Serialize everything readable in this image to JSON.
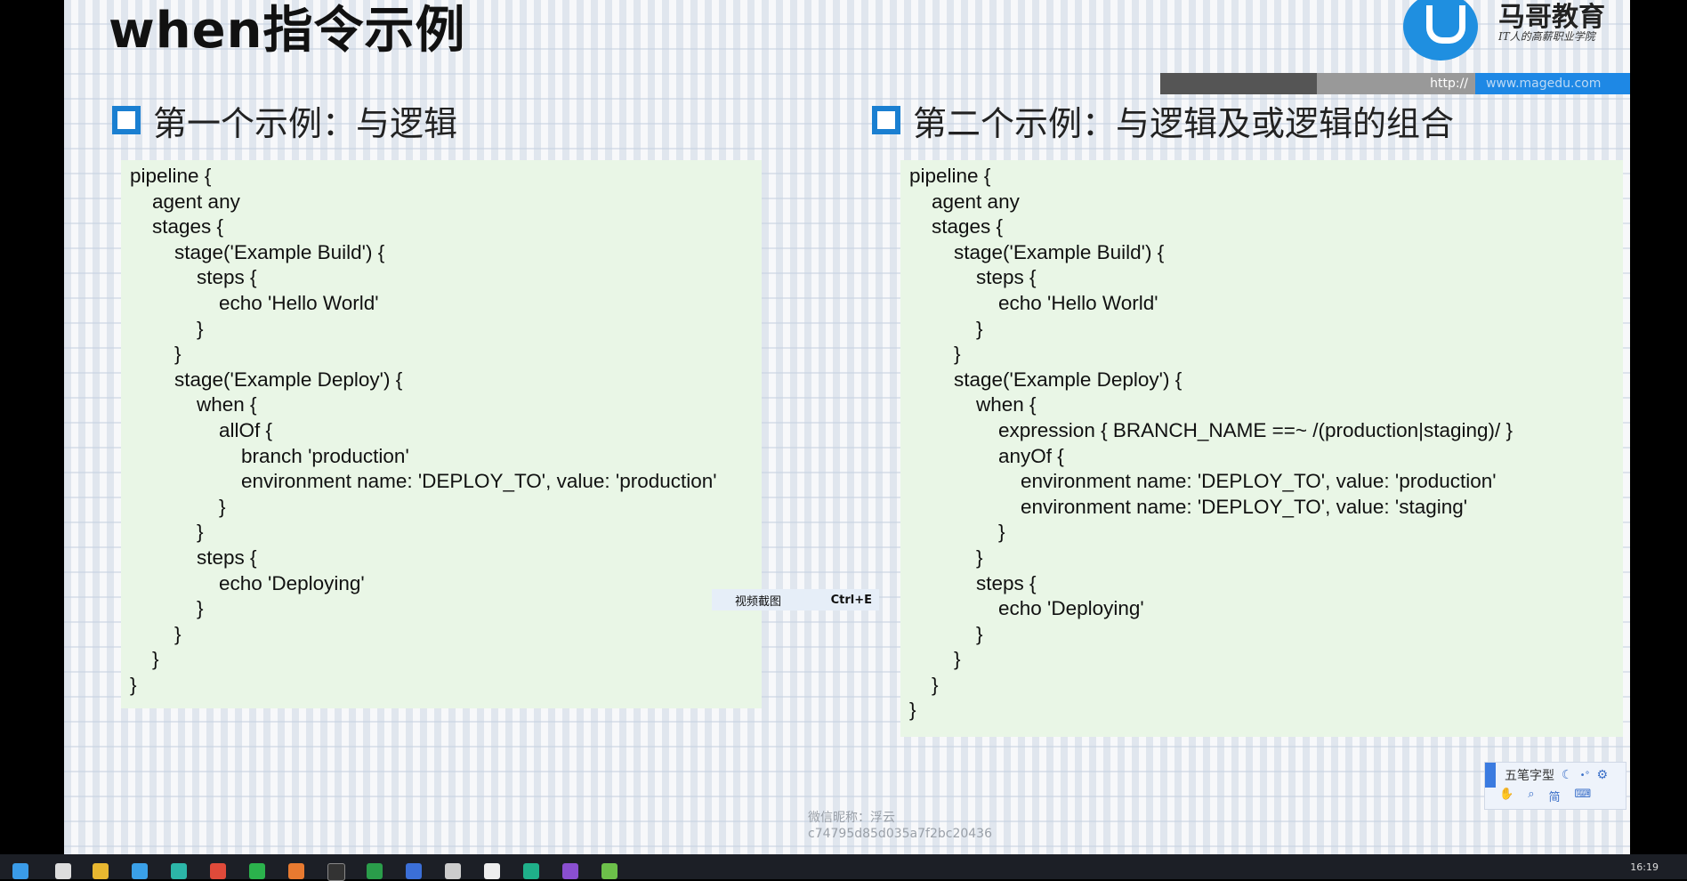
{
  "slide": {
    "title": "when指令示例",
    "logo": {
      "name": "马哥教育",
      "slogan": "IT人的高薪职业学院"
    },
    "urlbar": {
      "prefix": "http://",
      "site": "www.magedu.com"
    },
    "example1": {
      "heading": "第一个示例：与逻辑",
      "code": [
        "pipeline {",
        "    agent any",
        "    stages {",
        "        stage('Example Build') {",
        "            steps {",
        "                echo 'Hello World'",
        "            }",
        "        }",
        "        stage('Example Deploy') {",
        "            when {",
        "                allOf {",
        "                    branch 'production'",
        "                    environment name: 'DEPLOY_TO', value: 'production'",
        "                }",
        "            }",
        "            steps {",
        "                echo 'Deploying'",
        "            }",
        "        }",
        "    }",
        "}"
      ]
    },
    "example2": {
      "heading": "第二个示例：与逻辑及或逻辑的组合",
      "code": [
        "pipeline {",
        "    agent any",
        "    stages {",
        "        stage('Example Build') {",
        "            steps {",
        "                echo 'Hello World'",
        "            }",
        "        }",
        "        stage('Example Deploy') {",
        "            when {",
        "                expression { BRANCH_NAME ==~ /(production|staging)/ }",
        "                anyOf {",
        "                    environment name: 'DEPLOY_TO', value: 'production'",
        "                    environment name: 'DEPLOY_TO', value: 'staging'",
        "                }",
        "            }",
        "            steps {",
        "                echo 'Deploying'",
        "            }",
        "        }",
        "    }",
        "}"
      ]
    }
  },
  "tooltip": {
    "label": "视频截图",
    "shortcut": "Ctrl+E"
  },
  "watermark": {
    "line1": "微信昵称：浮云",
    "line2": "c74795d85d035a7f2bc20436"
  },
  "ime": {
    "label": "五笔字型",
    "mode": "简"
  },
  "taskbar": {
    "time": "16:19"
  },
  "colors": {
    "accent": "#1a7fd1",
    "code_bg": "#e9f6e6"
  }
}
